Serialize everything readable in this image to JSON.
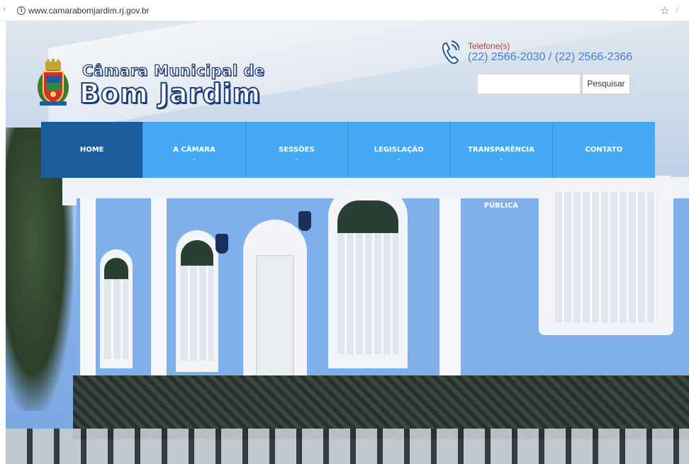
{
  "browser": {
    "url": "www.camarabomjardim.rj.gov.br"
  },
  "header": {
    "logo_line1": "Câmara Municipal de",
    "logo_line2": "Bom Jardim",
    "phone_label": "Telefone(s)",
    "phone_number": "(22) 2566-2030 / (22) 2566-2366"
  },
  "search": {
    "value": "",
    "placeholder": "",
    "button_label": "Pesquisar"
  },
  "nav": {
    "items": [
      {
        "label": "HOME",
        "has_dropdown": false,
        "active": true
      },
      {
        "label": "A CÂMARA",
        "has_dropdown": true,
        "active": false
      },
      {
        "label": "SESSÕES",
        "has_dropdown": true,
        "active": false
      },
      {
        "label": "LEGISLAÇÃO",
        "has_dropdown": true,
        "active": false
      },
      {
        "label": "TRANSPARÊNCIA PÚBLICA",
        "has_dropdown": true,
        "active": false
      },
      {
        "label": "CONTATO",
        "has_dropdown": false,
        "active": false
      }
    ],
    "colors": {
      "active": "#1c5d9e",
      "default": "#46a9f3"
    }
  },
  "icons": {
    "info": "info-icon",
    "bookmark": "star-icon",
    "phone": "phone-icon",
    "crest": "coat-of-arms-icon"
  }
}
